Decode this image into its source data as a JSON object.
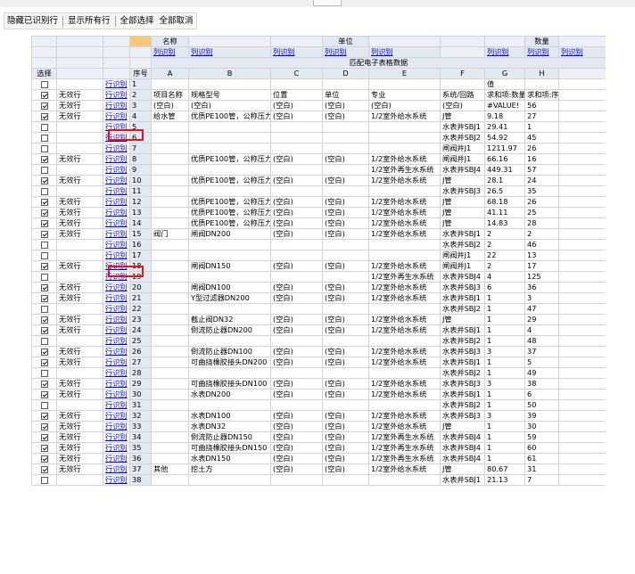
{
  "toolbar": {
    "items": [
      "隐藏已识别行",
      "显示所有行",
      "全部选择",
      "全部取消"
    ]
  },
  "header": {
    "group_labels": [
      "名称",
      "单位",
      "数量"
    ],
    "link_label": "列识别",
    "title": "匹配电子表格数据",
    "select_label": "选择",
    "seq_label": "序号",
    "letters": [
      "A",
      "B",
      "C",
      "D",
      "E",
      "F",
      "G",
      "H"
    ]
  },
  "rows": [
    {
      "checked": false,
      "status": "",
      "link": "行识别",
      "n": "1",
      "cells": [
        "",
        "",
        "",
        "",
        "",
        "",
        "值",
        ""
      ]
    },
    {
      "checked": true,
      "status": "无效行",
      "link": "行识别",
      "n": "2",
      "cells": [
        "项目名称",
        "规格型号",
        "位置",
        "单位",
        "专业",
        "系统/回路",
        "求和项:数量",
        "求和项:序号"
      ]
    },
    {
      "checked": true,
      "status": "无效行",
      "link": "行识别",
      "n": "3",
      "cells": [
        "(空白)",
        "(空白)",
        "(空白)",
        "(空白)",
        "(空白)",
        "(空白)",
        "#VALUE!",
        "56"
      ]
    },
    {
      "checked": true,
      "status": "无效行",
      "link": "行识别",
      "n": "4",
      "cells": [
        "给水管",
        "优质PE100管，公称压力",
        "(空白)",
        "(空白)",
        "1/2室外给水系统",
        "J管",
        "9.18",
        "27"
      ]
    },
    {
      "checked": false,
      "status": "",
      "link": "行识别",
      "n": "5",
      "cells": [
        "",
        "",
        "",
        "",
        "",
        "水表井SBJ1",
        "29.41",
        "1"
      ]
    },
    {
      "checked": false,
      "status": "",
      "link": "行识别",
      "n": "6",
      "cells": [
        "",
        "",
        "",
        "",
        "",
        "水表井SBJ2",
        "54.92",
        "45"
      ]
    },
    {
      "checked": false,
      "status": "",
      "link": "行识别",
      "n": "7",
      "cells": [
        "",
        "",
        "",
        "",
        "",
        "闸阀井J1",
        "1211.97",
        "26"
      ]
    },
    {
      "checked": true,
      "status": "无效行",
      "link": "行识别",
      "n": "8",
      "cells": [
        "",
        "优质PE100管，公称压力",
        "(空白)",
        "(空白)",
        "1/2室外给水系统",
        "闸阀井J1",
        "66.16",
        "16"
      ]
    },
    {
      "checked": false,
      "status": "",
      "link": "行识别",
      "n": "9",
      "cells": [
        "",
        "",
        "",
        "",
        "1/2室外再生水系统",
        "水表井SBJ4",
        "449.31",
        "57"
      ]
    },
    {
      "checked": true,
      "status": "无效行",
      "link": "行识别",
      "n": "10",
      "cells": [
        "",
        "优质PE100管，公称压力",
        "(空白)",
        "(空白)",
        "1/2室外给水系统",
        "J管",
        "28.1",
        "24"
      ]
    },
    {
      "checked": false,
      "status": "",
      "link": "行识别",
      "n": "11",
      "cells": [
        "",
        "",
        "",
        "",
        "",
        "水表井SBJ3",
        "26.5",
        "35"
      ]
    },
    {
      "checked": true,
      "status": "无效行",
      "link": "行识别",
      "n": "12",
      "cells": [
        "",
        "优质PE100管，公称压力",
        "(空白)",
        "(空白)",
        "1/2室外给水系统",
        "J管",
        "68.18",
        "26"
      ]
    },
    {
      "checked": true,
      "status": "无效行",
      "link": "行识别",
      "n": "13",
      "cells": [
        "",
        "优质PE100管，公称压力",
        "(空白)",
        "(空白)",
        "1/2室外给水系统",
        "J管",
        "41.11",
        "25"
      ]
    },
    {
      "checked": true,
      "status": "无效行",
      "link": "行识别",
      "n": "14",
      "cells": [
        "",
        "优质PE100管，公称压力",
        "(空白)",
        "(空白)",
        "1/2室外给水系统",
        "J管",
        "14.83",
        "28"
      ]
    },
    {
      "checked": true,
      "status": "无效行",
      "link": "行识别",
      "n": "15",
      "cells": [
        "阀门",
        "闸阀DN200",
        "(空白)",
        "(空白)",
        "1/2室外给水系统",
        "水表井SBJ1",
        "2",
        "2"
      ]
    },
    {
      "checked": false,
      "status": "",
      "link": "行识别",
      "n": "16",
      "cells": [
        "",
        "",
        "",
        "",
        "",
        "水表井SBJ2",
        "2",
        "46"
      ]
    },
    {
      "checked": false,
      "status": "",
      "link": "行识别",
      "n": "17",
      "cells": [
        "",
        "",
        "",
        "",
        "",
        "闸阀井J1",
        "22",
        "13"
      ]
    },
    {
      "checked": true,
      "status": "无效行",
      "link": "行识别",
      "n": "18",
      "cells": [
        "",
        "闸阀DN150",
        "(空白)",
        "(空白)",
        "1/2室外给水系统",
        "闸阀井J1",
        "2",
        "17"
      ]
    },
    {
      "checked": false,
      "status": "",
      "link": "行识别",
      "n": "19",
      "cells": [
        "",
        "",
        "",
        "",
        "1/2室外再生水系统",
        "水表井SBJ4",
        "4",
        "125"
      ]
    },
    {
      "checked": true,
      "status": "无效行",
      "link": "行识别",
      "n": "20",
      "cells": [
        "",
        "闸阀DN100",
        "(空白)",
        "(空白)",
        "1/2室外给水系统",
        "水表井SBJ3",
        "6",
        "36"
      ]
    },
    {
      "checked": true,
      "status": "无效行",
      "link": "行识别",
      "n": "21",
      "cells": [
        "",
        "Y型过滤器DN200",
        "(空白)",
        "(空白)",
        "1/2室外给水系统",
        "水表井SBJ1",
        "1",
        "3"
      ]
    },
    {
      "checked": false,
      "status": "",
      "link": "行识别",
      "n": "22",
      "cells": [
        "",
        "",
        "",
        "",
        "",
        "水表井SBJ2",
        "1",
        "47"
      ]
    },
    {
      "checked": true,
      "status": "无效行",
      "link": "行识别",
      "n": "23",
      "cells": [
        "",
        "截止阀DN32",
        "(空白)",
        "(空白)",
        "1/2室外给水系统",
        "J管",
        "1",
        "29"
      ]
    },
    {
      "checked": true,
      "status": "无效行",
      "link": "行识别",
      "n": "24",
      "cells": [
        "",
        "倒流防止器DN200",
        "(空白)",
        "(空白)",
        "1/2室外给水系统",
        "水表井SBJ1",
        "1",
        "4"
      ]
    },
    {
      "checked": false,
      "status": "",
      "link": "行识别",
      "n": "25",
      "cells": [
        "",
        "",
        "",
        "",
        "",
        "水表井SBJ2",
        "1",
        "48"
      ]
    },
    {
      "checked": true,
      "status": "无效行",
      "link": "行识别",
      "n": "26",
      "cells": [
        "",
        "倒流防止器DN100",
        "(空白)",
        "(空白)",
        "1/2室外给水系统",
        "水表井SBJ3",
        "3",
        "37"
      ]
    },
    {
      "checked": true,
      "status": "无效行",
      "link": "行识别",
      "n": "27",
      "cells": [
        "",
        "可曲挠橡胶接头DN200",
        "(空白)",
        "(空白)",
        "1/2室外给水系统",
        "水表井SBJ1",
        "1",
        "5"
      ]
    },
    {
      "checked": false,
      "status": "",
      "link": "行识别",
      "n": "28",
      "cells": [
        "",
        "",
        "",
        "",
        "",
        "水表井SBJ2",
        "1",
        "49"
      ]
    },
    {
      "checked": true,
      "status": "无效行",
      "link": "行识别",
      "n": "29",
      "cells": [
        "",
        "可曲挠橡胶接头DN100",
        "(空白)",
        "(空白)",
        "1/2室外给水系统",
        "水表井SBJ3",
        "3",
        "38"
      ]
    },
    {
      "checked": true,
      "status": "无效行",
      "link": "行识别",
      "n": "30",
      "cells": [
        "",
        "水表DN200",
        "(空白)",
        "(空白)",
        "1/2室外给水系统",
        "水表井SBJ1",
        "1",
        "6"
      ]
    },
    {
      "checked": false,
      "status": "",
      "link": "行识别",
      "n": "31",
      "cells": [
        "",
        "",
        "",
        "",
        "",
        "水表井SBJ2",
        "1",
        "50"
      ]
    },
    {
      "checked": true,
      "status": "无效行",
      "link": "行识别",
      "n": "32",
      "cells": [
        "",
        "水表DN100",
        "(空白)",
        "(空白)",
        "1/2室外给水系统",
        "水表井SBJ3",
        "3",
        "39"
      ]
    },
    {
      "checked": true,
      "status": "无效行",
      "link": "行识别",
      "n": "33",
      "cells": [
        "",
        "水表DN32",
        "(空白)",
        "(空白)",
        "1/2室外给水系统",
        "J管",
        "1",
        "30"
      ]
    },
    {
      "checked": true,
      "status": "无效行",
      "link": "行识别",
      "n": "34",
      "cells": [
        "",
        "倒流防止器DN150",
        "(空白)",
        "(空白)",
        "1/2室外再生水系统",
        "水表井SBJ4",
        "1",
        "59"
      ]
    },
    {
      "checked": true,
      "status": "无效行",
      "link": "行识别",
      "n": "35",
      "cells": [
        "",
        "可曲挠橡胶接头DN150",
        "(空白)",
        "(空白)",
        "1/2室外再生水系统",
        "水表井SBJ4",
        "1",
        "60"
      ]
    },
    {
      "checked": true,
      "status": "无效行",
      "link": "行识别",
      "n": "36",
      "cells": [
        "",
        "水表DN150",
        "(空白)",
        "(空白)",
        "1/2室外再生水系统",
        "水表井SBJ4",
        "1",
        "61"
      ]
    },
    {
      "checked": true,
      "status": "无效行",
      "link": "行识别",
      "n": "37",
      "cells": [
        "其他",
        "挖土方",
        "(空白)",
        "(空白)",
        "1/2室外给水系统",
        "J管",
        "80.67",
        "31"
      ]
    },
    {
      "checked": false,
      "status": "",
      "link": "行识别",
      "n": "38",
      "cells": [
        "",
        "",
        "",
        "",
        "",
        "水表井SBJ1",
        "21.13",
        "7"
      ]
    }
  ],
  "colors": {
    "highlight": "#e8121c",
    "link": "#0000dd",
    "header_bg": "#e3e9f2",
    "corner": "#f8c779"
  }
}
